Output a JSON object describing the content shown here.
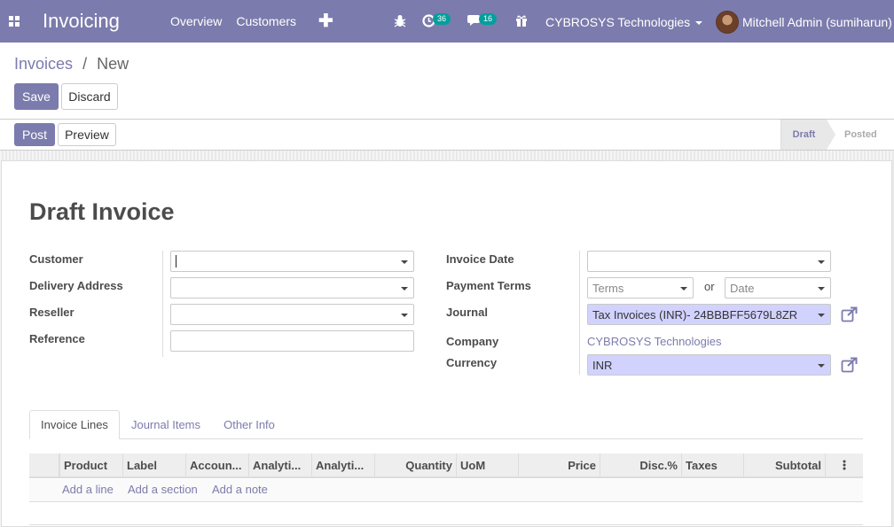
{
  "app": {
    "name": "Invoicing",
    "menu": [
      "Overview",
      "Customers"
    ],
    "activity_count": "36",
    "messages_count": "16",
    "company": "CYBROSYS Technologies",
    "user": "Mitchell Admin (sumiharun)"
  },
  "breadcrumb": {
    "parent": "Invoices",
    "separator": "/",
    "current": "New"
  },
  "actions": {
    "save": "Save",
    "discard": "Discard",
    "post": "Post",
    "preview": "Preview"
  },
  "status": {
    "stages": [
      "Draft",
      "Posted"
    ],
    "current": "Draft"
  },
  "form": {
    "title": "Draft Invoice",
    "left_labels": [
      "Customer",
      "Delivery Address",
      "Reseller",
      "Reference"
    ],
    "right_labels": [
      "Invoice Date",
      "Payment Terms",
      "Journal",
      "Company",
      "Currency"
    ],
    "customer": "",
    "delivery_address": "",
    "reseller": "",
    "reference": "",
    "invoice_date": "",
    "payment_terms_placeholder": "Terms",
    "or_label": "or",
    "due_date_placeholder": "Date",
    "journal": "Tax Invoices (INR)- 24BBBFF5679L8ZR",
    "company": "CYBROSYS Technologies",
    "currency": "INR"
  },
  "tabs": [
    "Invoice Lines",
    "Journal Items",
    "Other Info"
  ],
  "table": {
    "columns": [
      "Product",
      "Label",
      "Accoun...",
      "Analyti...",
      "Analyti...",
      "Quantity",
      "UoM",
      "Price",
      "Disc.%",
      "Taxes",
      "Subtotal"
    ],
    "add_links": [
      "Add a line",
      "Add a section",
      "Add a note"
    ]
  },
  "colors": {
    "navbar": "#7c7bad",
    "required_field": "#d2d2ff",
    "badge": "#00a09d"
  }
}
